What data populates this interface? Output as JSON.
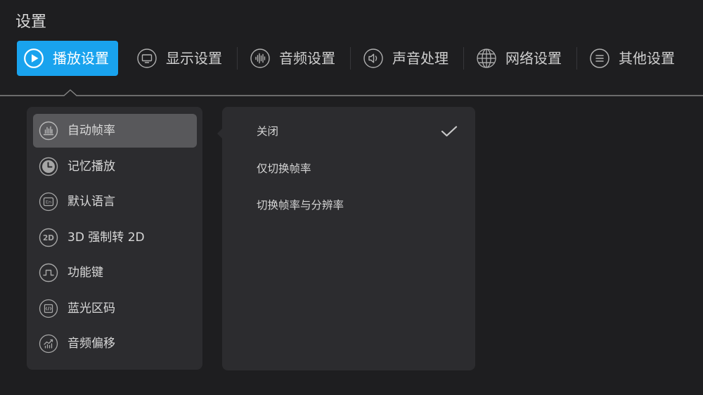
{
  "header": {
    "title": "设置"
  },
  "tabs": [
    {
      "label": "播放设置",
      "icon": "play-circle-icon",
      "active": true
    },
    {
      "label": "显示设置",
      "icon": "monitor-icon",
      "active": false
    },
    {
      "label": "音频设置",
      "icon": "audio-wave-icon",
      "active": false
    },
    {
      "label": "声音处理",
      "icon": "speaker-icon",
      "active": false
    },
    {
      "label": "网络设置",
      "icon": "globe-icon",
      "active": false
    },
    {
      "label": "其他设置",
      "icon": "list-icon",
      "active": false
    }
  ],
  "menu": {
    "items": [
      {
        "label": "自动帧率",
        "icon": "bar-chart-icon",
        "selected": true
      },
      {
        "label": "记忆播放",
        "icon": "clock-icon",
        "selected": false
      },
      {
        "label": "默认语言",
        "icon": "language-icon",
        "icon_text": "En",
        "selected": false
      },
      {
        "label": "3D 强制转 2D",
        "icon": "2d-icon",
        "icon_text": "2D",
        "selected": false
      },
      {
        "label": "功能键",
        "icon": "function-key-icon",
        "selected": false
      },
      {
        "label": "蓝光区码",
        "icon": "region-code-icon",
        "selected": false
      },
      {
        "label": "音频偏移",
        "icon": "audio-offset-icon",
        "selected": false
      }
    ]
  },
  "options": {
    "check_icon": "checkmark-icon",
    "items": [
      {
        "label": "关闭",
        "checked": true
      },
      {
        "label": "仅切换帧率",
        "checked": false
      },
      {
        "label": "切换帧率与分辨率",
        "checked": false
      }
    ]
  },
  "colors": {
    "accent": "#19a3ee",
    "background": "#1e1e20",
    "panel": "#2c2c2f",
    "highlight": "#58585b",
    "text": "#d6d6d6",
    "divider": "#858585"
  }
}
